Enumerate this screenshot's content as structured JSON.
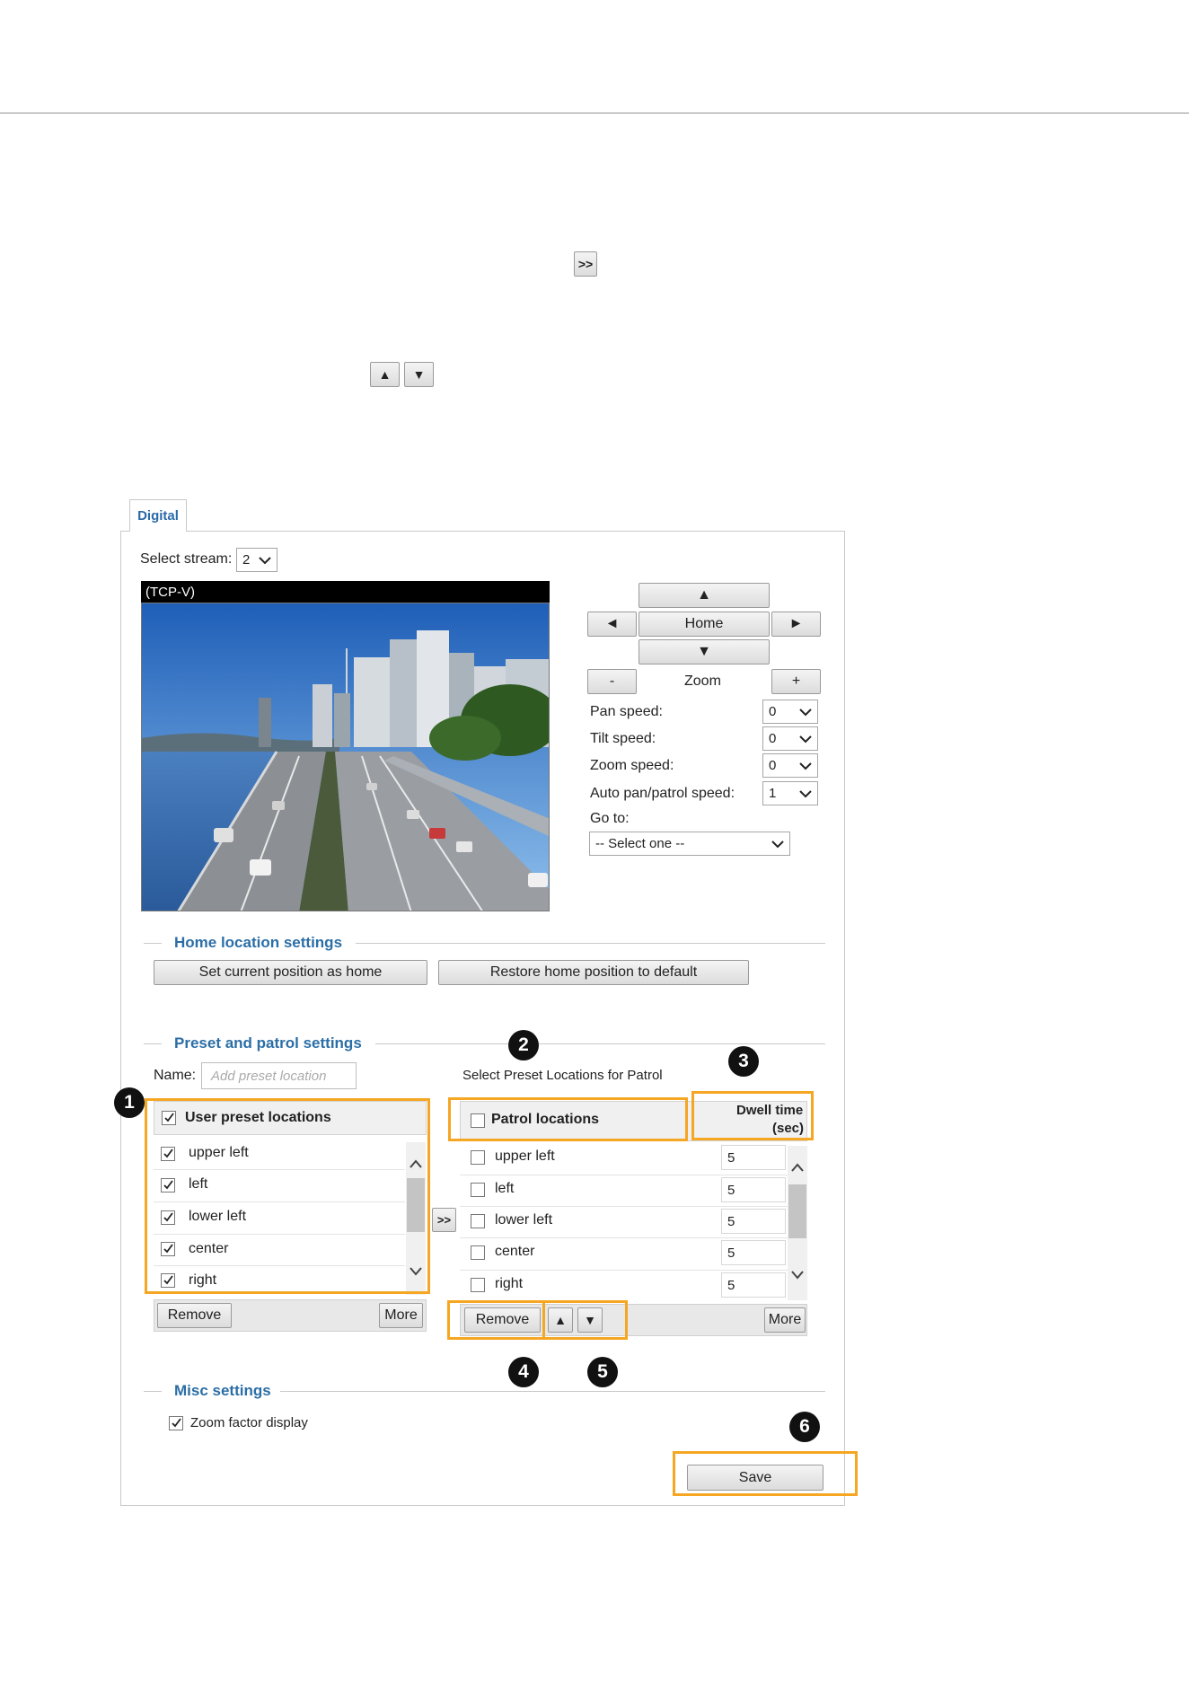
{
  "document": {
    "inline_buttons": {
      "add_to_patrol": ">>",
      "move_up": "▲",
      "move_down": "▼"
    }
  },
  "panel": {
    "tab_label": "Digital",
    "select_stream": {
      "label": "Select stream:",
      "value": "2"
    },
    "video": {
      "stream_label": "(TCP-V)"
    },
    "ptz": {
      "up": "▲",
      "left": "◄",
      "home": "Home",
      "right": "►",
      "down": "▼",
      "zoom_out": "-",
      "zoom_label": "Zoom",
      "zoom_in": "+",
      "pan_speed": {
        "label": "Pan speed:",
        "value": "0"
      },
      "tilt_speed": {
        "label": "Tilt speed:",
        "value": "0"
      },
      "zoom_speed": {
        "label": "Zoom speed:",
        "value": "0"
      },
      "auto_pan_speed": {
        "label": "Auto pan/patrol speed:",
        "value": "1"
      },
      "goto": {
        "label": "Go to:",
        "value": "-- Select one --"
      }
    },
    "home_location": {
      "title": "Home location settings",
      "set_current_button": "Set current position as home",
      "restore_default_button": "Restore home position to default"
    },
    "preset_patrol": {
      "title": "Preset and patrol settings",
      "name_label": "Name:",
      "name_placeholder": "Add preset location",
      "patrol_caption": "Select Preset Locations for Patrol",
      "user_presets": {
        "header": "User preset locations",
        "items": [
          "upper left",
          "left",
          "lower left",
          "center",
          "right"
        ],
        "remove_button": "Remove",
        "more_button": "More"
      },
      "add_button": ">>",
      "patrol": {
        "header": "Patrol locations",
        "dwell_header_line1": "Dwell time",
        "dwell_header_line2": "(sec)",
        "items": [
          {
            "label": "upper left",
            "dwell": "5"
          },
          {
            "label": "left",
            "dwell": "5"
          },
          {
            "label": "lower left",
            "dwell": "5"
          },
          {
            "label": "center",
            "dwell": "5"
          },
          {
            "label": "right",
            "dwell": "5"
          }
        ],
        "remove_button": "Remove",
        "up_button": "▲",
        "down_button": "▼",
        "more_button": "More"
      }
    },
    "misc": {
      "title": "Misc settings",
      "zoom_factor_display": "Zoom factor display"
    },
    "save_button": "Save"
  },
  "callouts": [
    "1",
    "2",
    "3",
    "4",
    "5",
    "6"
  ],
  "colors": {
    "accent_blue": "#2b6ea6",
    "highlight_orange": "#f5a623",
    "badge_black": "#111111"
  }
}
